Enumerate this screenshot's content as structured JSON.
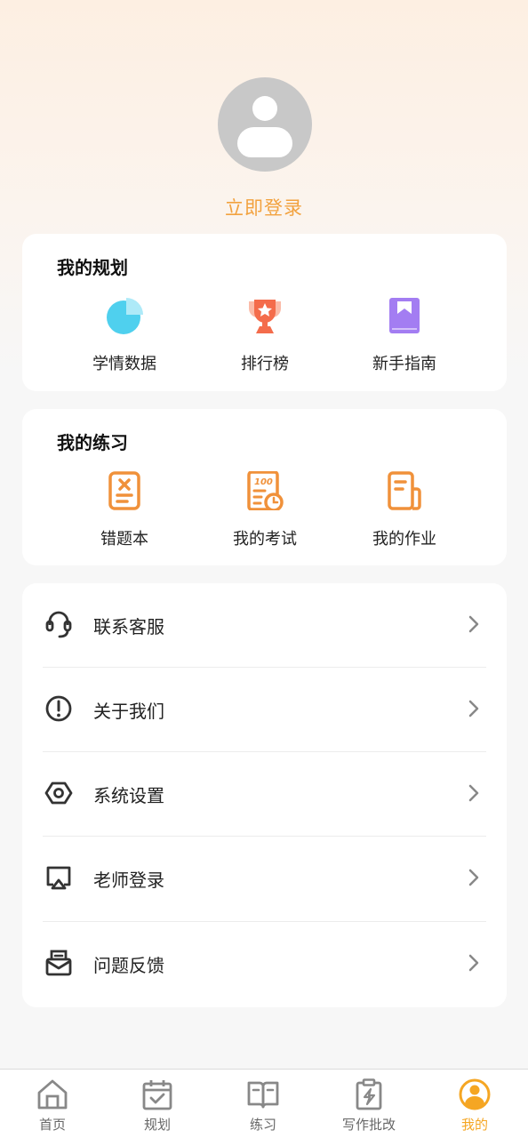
{
  "profile": {
    "login_text": "立即登录"
  },
  "plan_section": {
    "title": "我的规划",
    "items": [
      {
        "label": "学情数据",
        "icon": "pie-chart-icon",
        "color": "#4fd0ee"
      },
      {
        "label": "排行榜",
        "icon": "trophy-icon",
        "color": "#f46c4b"
      },
      {
        "label": "新手指南",
        "icon": "guide-book-icon",
        "color": "#a37df2"
      }
    ]
  },
  "practice_section": {
    "title": "我的练习",
    "items": [
      {
        "label": "错题本",
        "icon": "mistake-book-icon",
        "color": "#f0913a"
      },
      {
        "label": "我的考试",
        "icon": "exam-paper-icon",
        "color": "#f0913a"
      },
      {
        "label": "我的作业",
        "icon": "homework-icon",
        "color": "#f0913a"
      }
    ]
  },
  "menu": {
    "items": [
      {
        "label": "联系客服",
        "icon": "headset-icon"
      },
      {
        "label": "关于我们",
        "icon": "info-icon"
      },
      {
        "label": "系统设置",
        "icon": "settings-icon"
      },
      {
        "label": "老师登录",
        "icon": "teacher-screen-icon"
      },
      {
        "label": "问题反馈",
        "icon": "feedback-mail-icon"
      }
    ]
  },
  "tabbar": {
    "tabs": [
      {
        "label": "首页",
        "icon": "home-icon",
        "active": false
      },
      {
        "label": "规划",
        "icon": "calendar-check-icon",
        "active": false
      },
      {
        "label": "练习",
        "icon": "open-book-icon",
        "active": false
      },
      {
        "label": "写作批改",
        "icon": "writing-correction-icon",
        "active": false
      },
      {
        "label": "我的",
        "icon": "user-profile-icon",
        "active": true
      }
    ]
  },
  "colors": {
    "accent": "#f5a623",
    "login_text": "#f2a23f",
    "inactive_tab": "#666666"
  }
}
